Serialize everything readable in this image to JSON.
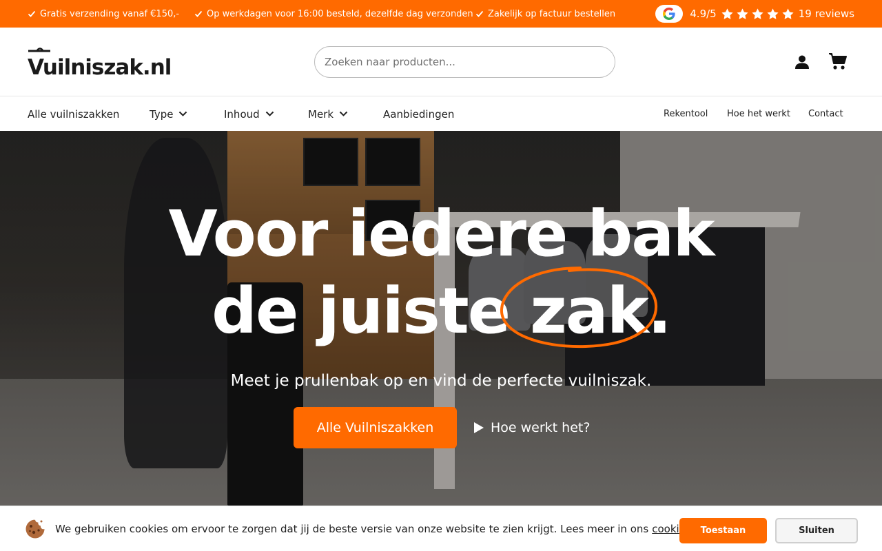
{
  "topbar": {
    "usps": [
      "Gratis verzending vanaf €150,-",
      "Op werkdagen voor 16:00 besteld, dezelfde dag verzonden",
      "Zakelijk op factuur bestellen"
    ],
    "rating_score": "4.9/5",
    "rating_stars": 5,
    "rating_reviews": "19 reviews"
  },
  "header": {
    "logo_text": "Vuilniszak.nl",
    "search_placeholder": "Zoeken naar producten...",
    "account_icon": "user-icon",
    "cart_icon": "shopping-cart-icon"
  },
  "nav": {
    "left": [
      {
        "label": "Alle vuilniszakken",
        "dropdown": false
      },
      {
        "label": "Type",
        "dropdown": true
      },
      {
        "label": "Inhoud",
        "dropdown": true
      },
      {
        "label": "Merk",
        "dropdown": true
      },
      {
        "label": "Aanbiedingen",
        "dropdown": false
      }
    ],
    "right": [
      {
        "label": "Rekentool"
      },
      {
        "label": "Hoe het werkt"
      },
      {
        "label": "Contact"
      }
    ]
  },
  "hero": {
    "title_line1": "Voor iedere bak",
    "title_line2": "de juiste zak.",
    "subtitle": "Meet je prullenbak op en vind de perfecte vuilniszak.",
    "primary_button": "Alle Vuilniszakken",
    "video_button": "Hoe werkt het?"
  },
  "cookie": {
    "text": "We gebruiken cookies om ervoor te zorgen dat jij de beste versie van onze website te zien krijgt. Lees meer in ons",
    "link": "cookie beleid",
    "accept": "Toestaan",
    "close": "Sluiten"
  },
  "colors": {
    "accent": "#ff6a00",
    "text": "#222222",
    "white": "#ffffff"
  }
}
